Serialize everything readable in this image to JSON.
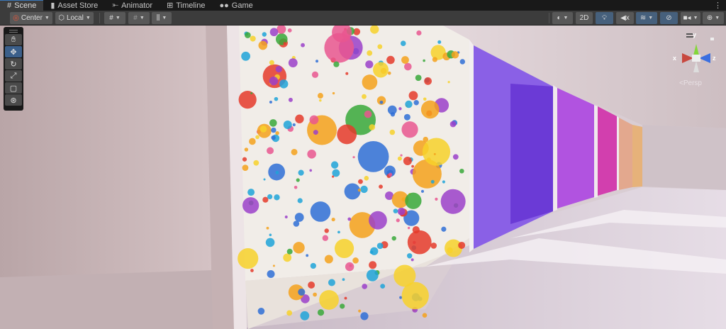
{
  "tabs": [
    {
      "label": "Scene",
      "icon": "hash-icon",
      "active": true
    },
    {
      "label": "Asset Store",
      "icon": "bag-icon"
    },
    {
      "label": "Animator",
      "icon": "animator-icon"
    },
    {
      "label": "Timeline",
      "icon": "film-icon"
    },
    {
      "label": "Game",
      "icon": "gamepad-icon"
    }
  ],
  "toolbar": {
    "pivot": "Center",
    "space": "Local",
    "mode_2d": "2D"
  },
  "tools": [
    "hand",
    "move",
    "rotate",
    "scale",
    "rect",
    "transform"
  ],
  "gizmo": {
    "x": "x",
    "y": "y",
    "z": "z",
    "projection": "Persp"
  },
  "colors": {
    "accent": "#3a79bb",
    "active_button": "#46607c"
  }
}
